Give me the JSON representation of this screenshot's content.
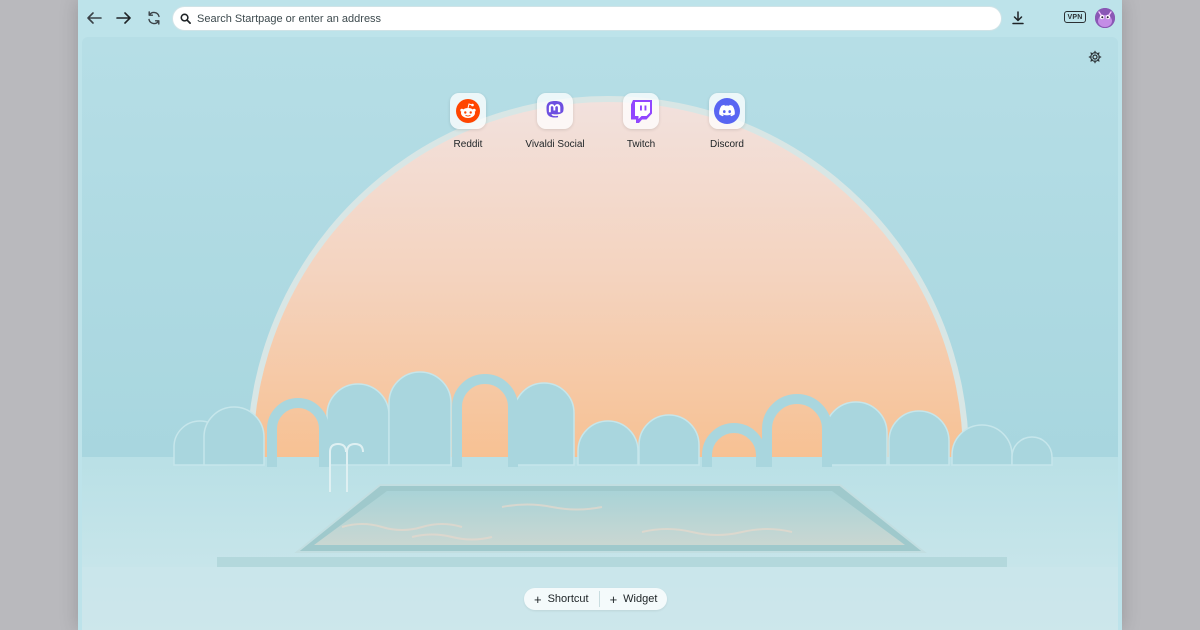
{
  "toolbar": {
    "back_icon": "arrow-left-icon",
    "forward_icon": "arrow-right-icon",
    "reload_icon": "reload-icon",
    "address_placeholder": "Search Startpage or enter an address",
    "download_icon": "download-icon",
    "vpn_label": "VPN",
    "avatar_icon": "profile-avatar"
  },
  "speed_dial": [
    {
      "label": "Reddit",
      "icon": "reddit-icon",
      "color": "#ff4500"
    },
    {
      "label": "Vivaldi Social",
      "icon": "mastodon-icon",
      "color": "#6d4fe0"
    },
    {
      "label": "Twitch",
      "icon": "twitch-icon",
      "color": "#9146ff"
    },
    {
      "label": "Discord",
      "icon": "discord-icon",
      "color": "#5865f2"
    }
  ],
  "add_bar": {
    "shortcut_label": "Shortcut",
    "widget_label": "Widget"
  },
  "settings_icon": "gear-icon",
  "colors": {
    "frame": "#bde3ea",
    "sky": "#a9d8e0",
    "sun_top": "#f3ddd6",
    "sun_bottom": "#f6c59a"
  }
}
